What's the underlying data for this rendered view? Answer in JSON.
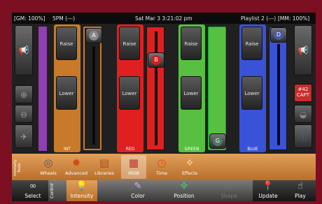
{
  "status": {
    "gm": "[GM: 100%]",
    "time_preset": "5PM (---)",
    "datetime": "Sat Mar 3 3:21:02 pm",
    "playlist": "Playlist 2 (---)",
    "mm": "[MM: 100%]"
  },
  "channels": [
    {
      "label": "INT",
      "color": "#c87a2a",
      "knob": "A",
      "level": 0.82
    },
    {
      "label": "RED",
      "color": "#e02020",
      "knob": "B",
      "level": 0.6
    },
    {
      "label": "GREEN",
      "color": "#58c040",
      "knob": "G",
      "level": 0.0
    },
    {
      "label": "BLUE",
      "color": "#3a52d8",
      "knob": "D",
      "level": 0.95
    }
  ],
  "fader_buttons": {
    "raise": "Raise",
    "lower": "Lower"
  },
  "badge": {
    "number": "#42",
    "text": "CAPT"
  },
  "tools": {
    "section_label": "Intensity Tools",
    "items": [
      {
        "label": "Wheels",
        "icon": "wheels-icon",
        "glyph": "◎"
      },
      {
        "label": "Advanced",
        "icon": "advanced-gear-icon",
        "glyph": "✹"
      },
      {
        "label": "Libraries",
        "icon": "libraries-icon",
        "glyph": "▤"
      },
      {
        "label": "IRGB",
        "icon": "irgb-icon",
        "glyph": "▦"
      },
      {
        "label": "Time",
        "icon": "clock-icon",
        "glyph": "◷"
      },
      {
        "label": "Effects",
        "icon": "effects-wand-icon",
        "glyph": "✧"
      }
    ]
  },
  "bottom": {
    "select": "Select",
    "control_label": "Control",
    "intensity": "Intensity",
    "color": "Color",
    "position": "Position",
    "shape": "Shape",
    "update": "Update",
    "play": "Play"
  }
}
